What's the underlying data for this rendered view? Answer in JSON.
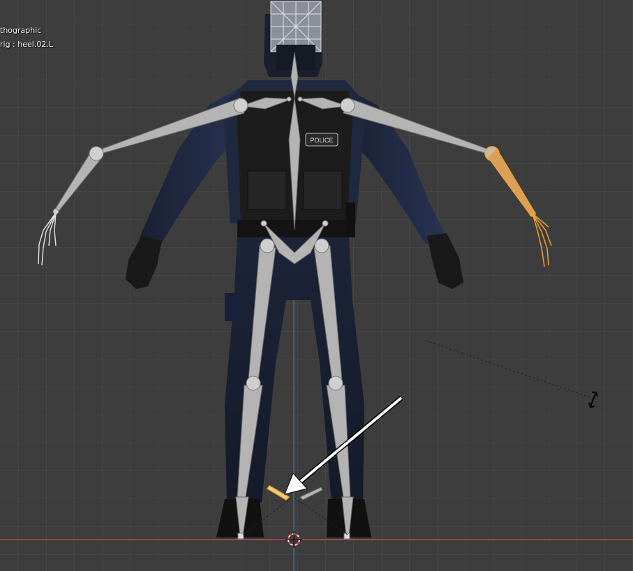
{
  "viewport": {
    "view_mode_label": "thographic",
    "active_object_label": "rig : heel.02.L"
  },
  "vest_patch": {
    "text": "POLICE"
  },
  "colors": {
    "viewport_bg": "#3d3d3d",
    "grid_line": "#454545",
    "bone_default": "#b4b4b4",
    "bone_selected": "#f0a030",
    "x_axis": "#b84a4a",
    "z_axis": "#3d6fa8",
    "annotation_arrow": "#ffffff"
  },
  "icons": {
    "cursor": "3d-cursor-icon",
    "resize": "resize-cursor-icon"
  }
}
